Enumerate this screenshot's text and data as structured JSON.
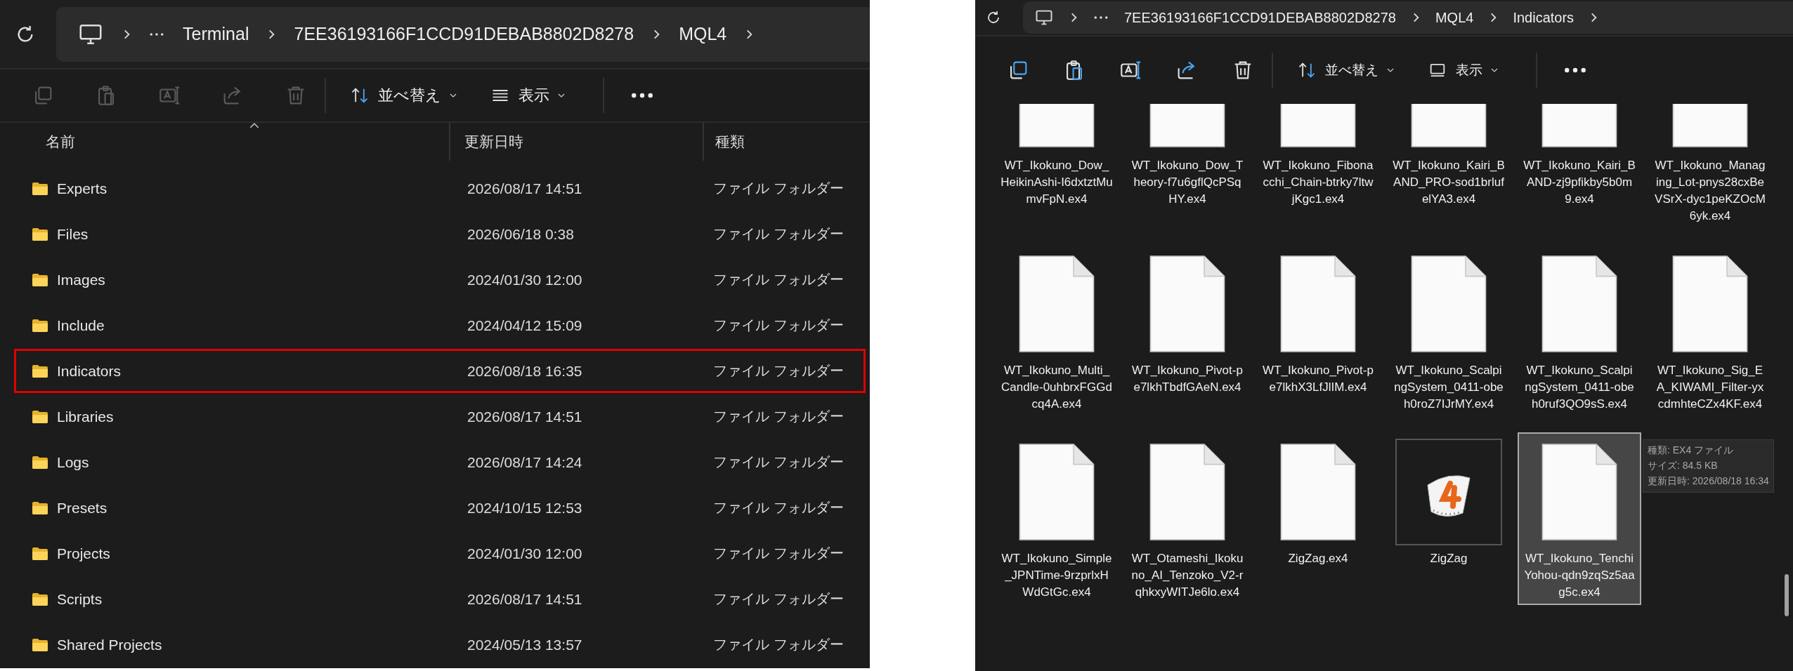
{
  "left_window": {
    "breadcrumbs": [
      "Terminal",
      "7EE36193166F1CCD91DEBAB8802D8278",
      "MQL4"
    ],
    "toolbar": {
      "actions": [
        {
          "kind": "copy",
          "disabled": true
        },
        {
          "kind": "paste",
          "disabled": true
        },
        {
          "kind": "rename",
          "disabled": true
        },
        {
          "kind": "share",
          "disabled": true
        },
        {
          "kind": "delete",
          "disabled": true
        }
      ],
      "sort_label": "並べ替え",
      "view_label": "表示"
    },
    "columns": [
      "名前",
      "更新日時",
      "種類"
    ],
    "rows": [
      {
        "name": "Experts",
        "modified": "2026/08/17 14:51",
        "type": "ファイル フォルダー",
        "highlighted": false
      },
      {
        "name": "Files",
        "modified": "2026/06/18 0:38",
        "type": "ファイル フォルダー",
        "highlighted": false
      },
      {
        "name": "Images",
        "modified": "2024/01/30 12:00",
        "type": "ファイル フォルダー",
        "highlighted": false
      },
      {
        "name": "Include",
        "modified": "2024/04/12 15:09",
        "type": "ファイル フォルダー",
        "highlighted": false
      },
      {
        "name": "Indicators",
        "modified": "2026/08/18 16:35",
        "type": "ファイル フォルダー",
        "highlighted": true
      },
      {
        "name": "Libraries",
        "modified": "2026/08/17 14:51",
        "type": "ファイル フォルダー",
        "highlighted": false
      },
      {
        "name": "Logs",
        "modified": "2026/08/17 14:24",
        "type": "ファイル フォルダー",
        "highlighted": false
      },
      {
        "name": "Presets",
        "modified": "2024/10/15 12:53",
        "type": "ファイル フォルダー",
        "highlighted": false
      },
      {
        "name": "Projects",
        "modified": "2024/01/30 12:00",
        "type": "ファイル フォルダー",
        "highlighted": false
      },
      {
        "name": "Scripts",
        "modified": "2026/08/17 14:51",
        "type": "ファイル フォルダー",
        "highlighted": false
      },
      {
        "name": "Shared Projects",
        "modified": "2024/05/13 13:57",
        "type": "ファイル フォルダー",
        "highlighted": false
      }
    ]
  },
  "right_window": {
    "breadcrumbs": [
      "7EE36193166F1CCD91DEBAB8802D8278",
      "MQL4",
      "Indicators"
    ],
    "toolbar": {
      "actions": [
        {
          "kind": "copy",
          "disabled": false
        },
        {
          "kind": "paste",
          "disabled": false
        },
        {
          "kind": "rename",
          "disabled": false
        },
        {
          "kind": "share",
          "disabled": false
        },
        {
          "kind": "delete",
          "disabled": false
        }
      ],
      "sort_label": "並べ替え",
      "view_label": "表示"
    },
    "tiles": [
      {
        "name": "WT_Ikokuno_Dow_HeikinAshi-I6dxtztMumvFpN.ex4",
        "kind": "file",
        "selected": false
      },
      {
        "name": "WT_Ikokuno_Dow_Theory-f7u6gflQcPSqHY.ex4",
        "kind": "file",
        "selected": false
      },
      {
        "name": "WT_Ikokuno_Fibonacchi_Chain-btrky7ltwjKgc1.ex4",
        "kind": "file",
        "selected": false
      },
      {
        "name": "WT_Ikokuno_Kairi_BAND_PRO-sod1brlufelYA3.ex4",
        "kind": "file",
        "selected": false
      },
      {
        "name": "WT_Ikokuno_Kairi_BAND-zj9pfikby5b0m9.ex4",
        "kind": "file",
        "selected": false
      },
      {
        "name": "WT_Ikokuno_Managing_Lot-pnys28cxBeVSrX-dyc1peKZOcM6yk.ex4",
        "kind": "file",
        "selected": false
      },
      {
        "name": "WT_Ikokuno_Multi_Candle-0uhbrxFGGdcq4A.ex4",
        "kind": "file",
        "selected": false
      },
      {
        "name": "WT_Ikokuno_Pivot-pe7lkhTbdfGAeN.ex4",
        "kind": "file",
        "selected": false
      },
      {
        "name": "WT_Ikokuno_Pivot-pe7lkhX3LfJlIM.ex4",
        "kind": "file",
        "selected": false
      },
      {
        "name": "WT_Ikokuno_ScalpingSystem_0411-obeh0roZ7IJrMY.ex4",
        "kind": "file",
        "selected": false
      },
      {
        "name": "WT_Ikokuno_ScalpingSystem_0411-obeh0ruf3QO9sS.ex4",
        "kind": "file",
        "selected": false
      },
      {
        "name": "WT_Ikokuno_Sig_EA_KIWAMI_Filter-yxcdmhteCZx4KF.ex4",
        "kind": "file",
        "selected": false
      },
      {
        "name": "WT_Ikokuno_Simple_JPNTime-9rzprlxHWdGtGc.ex4",
        "kind": "file",
        "selected": false
      },
      {
        "name": "WT_Otameshi_Ikokuno_AI_Tenzoko_V2-rqhkxyWITJe6lo.ex4",
        "kind": "file",
        "selected": false
      },
      {
        "name": "ZigZag.ex4",
        "kind": "file",
        "selected": false
      },
      {
        "name": "ZigZag",
        "kind": "source",
        "selected": false
      },
      {
        "name": "WT_Ikokuno_TenchiYohou-qdn9zqSz5aag5c.ex4",
        "kind": "file",
        "selected": true
      }
    ],
    "tooltip": [
      "種類: EX4 ファイル",
      "サイズ: 84.5 KB",
      "更新日時: 2026/08/18 16:34"
    ]
  }
}
